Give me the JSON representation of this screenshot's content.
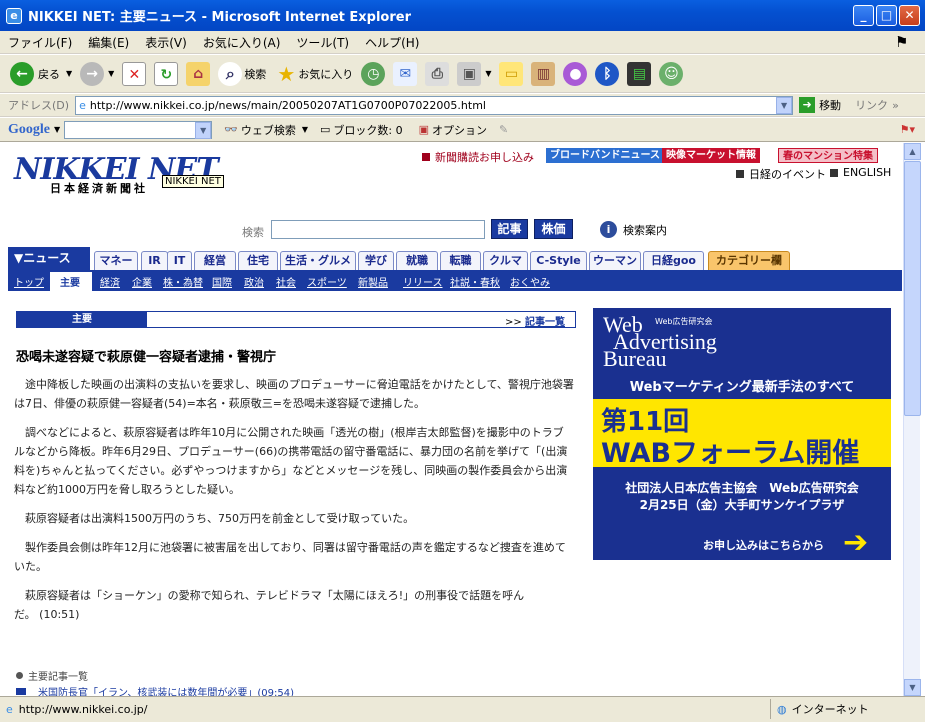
{
  "window": {
    "title": "NIKKEI NET: 主要ニュース - Microsoft Internet Explorer"
  },
  "menu": [
    "ファイル(F)",
    "編集(E)",
    "表示(V)",
    "お気に入り(A)",
    "ツール(T)",
    "ヘルプ(H)"
  ],
  "toolbar": {
    "back": "戻る",
    "search": "検索",
    "favorites": "お気に入り"
  },
  "address": {
    "label": "アドレス(D)",
    "url": "http://www.nikkei.co.jp/news/main/20050207AT1G0700P07022005.html",
    "go": "移動",
    "links": "リンク"
  },
  "google": {
    "brand": "Google",
    "web_search": "ウェブ検索",
    "popup_block": "ブロック数: 0",
    "options": "オプション"
  },
  "site": {
    "logo": "NIKKEI NET",
    "logo_sub": "日本経済新聞社",
    "logo_tooltip": "NIKKEI NET",
    "subscribe": "新聞購読お申し込み",
    "btn_broadband": "ブロードバンドニュース",
    "btn_video": "映像マーケット情報",
    "btn_mansion": "春のマンション特集",
    "events": "日経のイベント",
    "english": "ENGLISH",
    "search_label": "検索",
    "btn_article": "記事",
    "btn_stock": "株価",
    "search_help": "検索案内"
  },
  "tabs": [
    "▼ニュース",
    "マネー",
    "IR",
    "IT",
    "経営",
    "住宅",
    "生活・グルメ",
    "学び",
    "就職",
    "転職",
    "クルマ",
    "C-Style",
    "ウーマン",
    "日経goo",
    "カテゴリー欄"
  ],
  "subnav": [
    "トップ",
    "主要",
    "経済",
    "企業",
    "株・為替",
    "国際",
    "政治",
    "社会",
    "スポーツ",
    "新製品",
    "リリース",
    "社説・春秋",
    "おくやみ"
  ],
  "section": {
    "title": "主要",
    "list_link": "記事一覧",
    "list_prefix": ">>"
  },
  "article": {
    "headline": "恐喝未遂容疑で萩原健一容疑者逮捕・警視庁",
    "paragraphs": [
      "途中降板した映画の出演料の支払いを要求し、映画のプロデューサーに脅迫電話をかけたとして、警視庁池袋署は7日、俳優の萩原健一容疑者(54)=本名・萩原敬三=を恐喝未遂容疑で逮捕した。",
      "調べなどによると、萩原容疑者は昨年10月に公開された映画「透光の樹」(根岸吉太郎監督)を撮影中のトラブルなどから降板。昨年6月29日、プロデューサー(66)の携帯電話の留守番電話に、暴力団の名前を挙げて「(出演料を)ちゃんと払ってください。必ずやっつけますから」などとメッセージを残し、同映画の製作委員会から出演料など約1000万円を脅し取ろうとした疑い。",
      "萩原容疑者は出演料1500万円のうち、750万円を前金として受け取っていた。",
      "製作委員会側は昨年12月に池袋署に被害届を出しており、同署は留守番電話の声を鑑定するなど捜査を進めていた。",
      "萩原容疑者は「ショーケン」の愛称で知られ、テレビドラマ「太陽にほえろ!」の刑事役で話題を呼んだ。 (10:51)"
    ],
    "related_title": "主要記事一覧",
    "related_first": "米国防長官「イラン、核武装には数年間が必要」(09:54)"
  },
  "ad": {
    "logo_line1": "Web",
    "logo_line2": "Advertising",
    "logo_line3": "Bureau",
    "logo_small": "Web広告研究会",
    "headline": "Webマーケティング最新手法のすべて",
    "big1": "第11回",
    "big2": "WABフォーラム開催",
    "org": "社団法人日本広告主協会　Web広告研究会",
    "date": "2月25日（金）大手町サンケイプラザ",
    "cta": "お申し込みはこちらから"
  },
  "status": {
    "url": "http://www.nikkei.co.jp/",
    "zone": "インターネット"
  },
  "colors": {
    "navy": "#1a3aa0",
    "red": "#c8102e",
    "yellow": "#ffe600"
  }
}
